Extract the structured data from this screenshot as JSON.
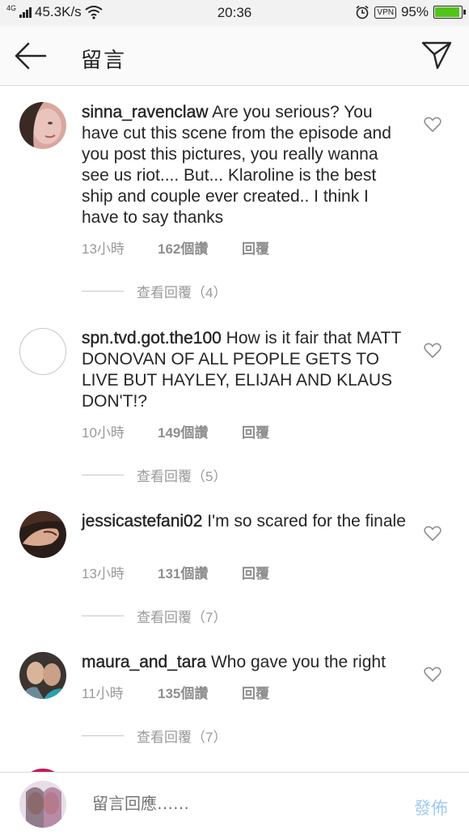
{
  "status_bar": {
    "network": "4G",
    "speed": "45.3K/s",
    "time": "20:36",
    "vpn": "VPN",
    "battery": "95%",
    "battery_level": 0.95
  },
  "header": {
    "title": "留言"
  },
  "comments": [
    {
      "username": "sinna_ravenclaw",
      "text": "Are you serious? You have cut this scene from the episode and you post this pictures, you really wanna see us riot.... But... Klaroline is the best ship and couple ever created.. I think I have to say thanks",
      "time": "13小時",
      "likes": "162個讚",
      "reply": "回覆",
      "view_replies": "查看回覆（4）"
    },
    {
      "username": "spn.tvd.got.the100",
      "text": "How is it fair that MATT DONOVAN OF ALL PEOPLE GETS TO LIVE BUT HAYLEY, ELIJAH AND KLAUS DON'T!?",
      "time": "10小時",
      "likes": "149個讚",
      "reply": "回覆",
      "view_replies": "查看回覆（5）"
    },
    {
      "username": "jessicastefani02",
      "text": "I'm so scared for the finale",
      "time": "13小時",
      "likes": "131個讚",
      "reply": "回覆",
      "view_replies": "查看回覆（7）"
    },
    {
      "username": "maura_and_tara",
      "text": "Who gave you the right",
      "time": "11小時",
      "likes": "135個讚",
      "reply": "回覆",
      "view_replies": "查看回覆（7）"
    }
  ],
  "footer": {
    "placeholder": "留言回應……",
    "post_label": "發佈"
  },
  "colors": {
    "accent_disabled": "#9fcaf1",
    "meta_gray": "#999999",
    "battery_green": "#52c41a"
  }
}
